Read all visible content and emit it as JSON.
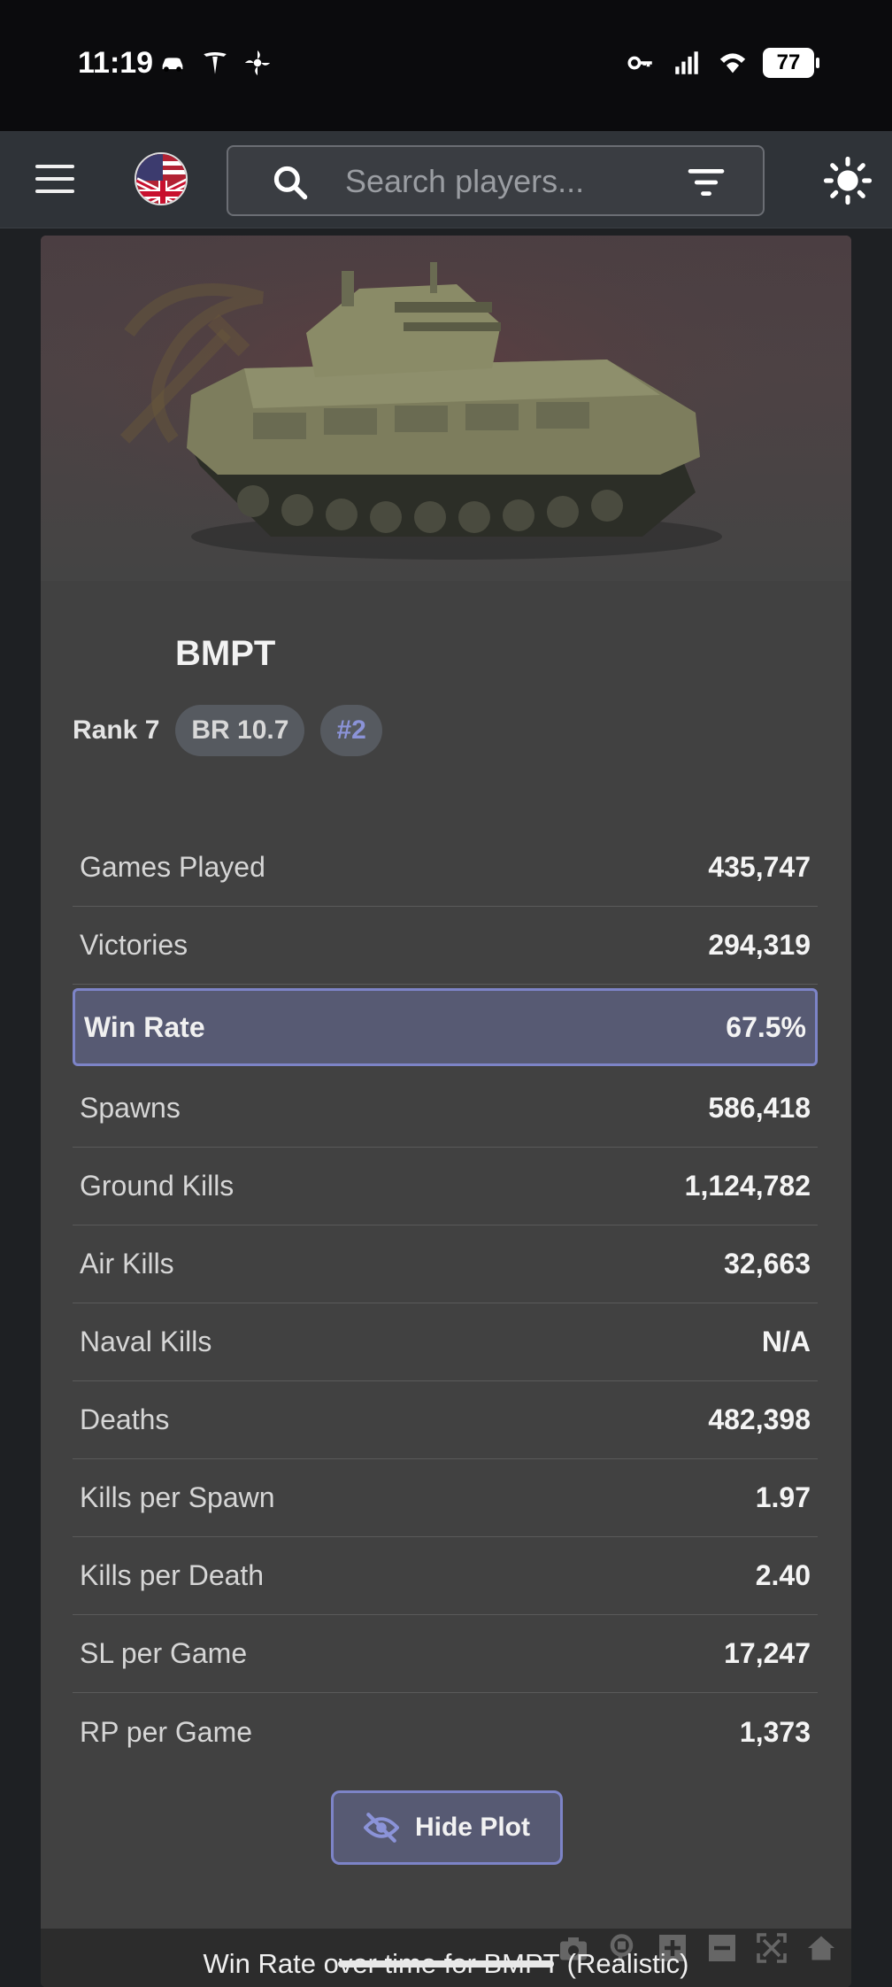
{
  "status_bar": {
    "time": "11:19",
    "battery": "77",
    "left_icons": [
      "car-icon",
      "tesla-icon",
      "fan-icon"
    ],
    "right_icons": [
      "key-icon",
      "signal-icon",
      "wifi-icon",
      "battery-icon"
    ]
  },
  "app_bar": {
    "search_placeholder": "Search players...",
    "icons": [
      "menu-icon",
      "us-uk-flag-icon",
      "search-icon",
      "filter-icon",
      "sun-icon"
    ]
  },
  "vehicle": {
    "name": "BMPT",
    "rank": "Rank 7",
    "br": "BR 10.7",
    "position": "#2",
    "image": "tank-image"
  },
  "stats": [
    {
      "label": "Games Played",
      "value": "435,747"
    },
    {
      "label": "Victories",
      "value": "294,319"
    },
    {
      "label": "Win Rate",
      "value": "67.5%",
      "highlight": true
    },
    {
      "label": "Spawns",
      "value": "586,418"
    },
    {
      "label": "Ground Kills",
      "value": "1,124,782"
    },
    {
      "label": "Air Kills",
      "value": "32,663"
    },
    {
      "label": "Naval Kills",
      "value": "N/A"
    },
    {
      "label": "Deaths",
      "value": "482,398"
    },
    {
      "label": "Kills per Spawn",
      "value": "1.97"
    },
    {
      "label": "Kills per Death",
      "value": "2.40"
    },
    {
      "label": "SL per Game",
      "value": "17,247"
    },
    {
      "label": "RP per Game",
      "value": "1,373"
    }
  ],
  "hide_plot_label": "Hide Plot",
  "plot": {
    "title": "Win Rate over time for BMPT (Realistic)",
    "toolbar": [
      "camera-icon",
      "zoom-icon",
      "zoom-in-icon",
      "zoom-out-icon",
      "autoscale-icon",
      "home-icon"
    ]
  },
  "colors": {
    "accent": "#7d84c8",
    "highlight_bg": "#575a73",
    "card_bg": "#414141",
    "page_bg": "#1e2023"
  }
}
